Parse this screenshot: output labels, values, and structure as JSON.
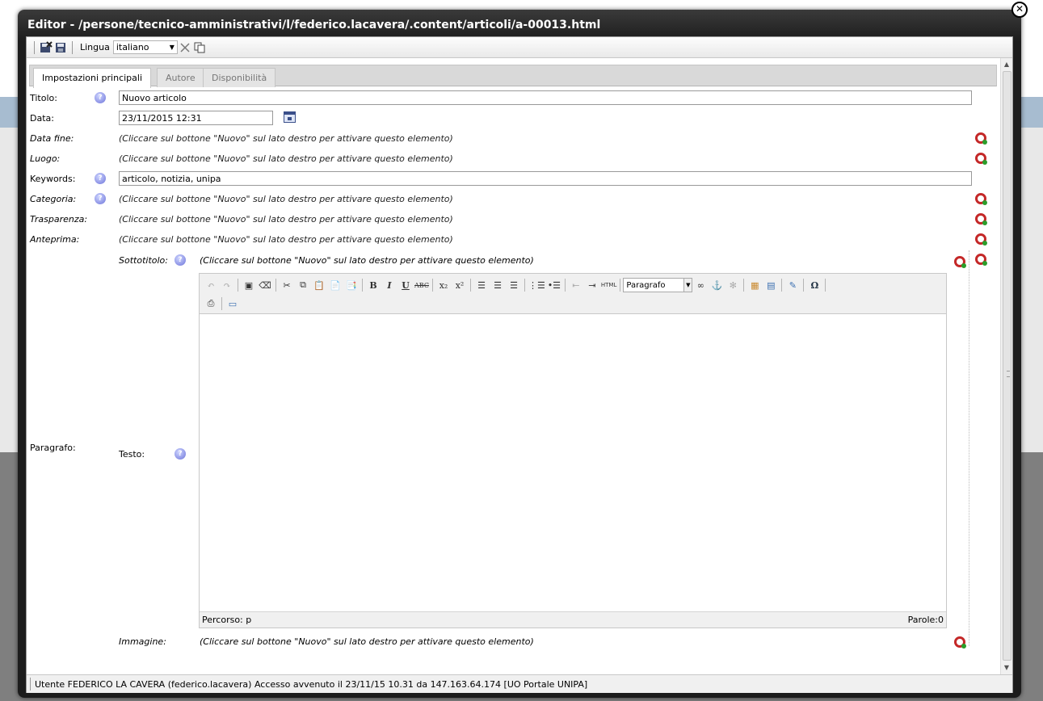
{
  "window": {
    "title": "Editor - /persone/tecnico-amministrativi/l/federico.lacavera/.content/articoli/a-00013.html",
    "close_label": "✕"
  },
  "toolbar": {
    "language_label": "Lingua",
    "language_value": "italiano",
    "icons": [
      "save-exit-icon",
      "save-icon",
      "delete-language-icon",
      "copy-language-icon"
    ]
  },
  "tabs": [
    {
      "label": "Impostazioni principali",
      "active": true
    },
    {
      "label": "Autore",
      "active": false
    },
    {
      "label": "Disponibilità",
      "active": false
    }
  ],
  "fields": {
    "titolo": {
      "label": "Titolo:",
      "value": "Nuovo articolo"
    },
    "data": {
      "label": "Data:",
      "value": "23/11/2015 12:31"
    },
    "data_fine": {
      "label": "Data fine:",
      "hint": "(Cliccare sul bottone \"Nuovo\" sul lato destro per attivare questo elemento)"
    },
    "luogo": {
      "label": "Luogo:",
      "hint": "(Cliccare sul bottone \"Nuovo\" sul lato destro per attivare questo elemento)"
    },
    "keywords": {
      "label": "Keywords:",
      "value": "articolo, notizia, unipa"
    },
    "categoria": {
      "label": "Categoria:",
      "hint": "(Cliccare sul bottone \"Nuovo\" sul lato destro per attivare questo elemento)"
    },
    "trasparenza": {
      "label": "Trasparenza:",
      "hint": "(Cliccare sul bottone \"Nuovo\" sul lato destro per attivare questo elemento)"
    },
    "anteprima": {
      "label": "Anteprima:",
      "hint": "(Cliccare sul bottone \"Nuovo\" sul lato destro per attivare questo elemento)"
    }
  },
  "paragrafo": {
    "label": "Paragrafo:",
    "sottotitolo": {
      "label": "Sottotitolo:",
      "hint": "(Cliccare sul bottone \"Nuovo\" sul lato destro per attivare questo elemento)"
    },
    "testo": {
      "label": "Testo:"
    },
    "immagine": {
      "label": "Immagine:",
      "hint": "(Cliccare sul bottone \"Nuovo\" sul lato destro per attivare questo elemento)"
    },
    "editor": {
      "format_value": "Paragrafo",
      "path_label": "Percorso: p",
      "word_count": "Parole:0"
    }
  },
  "status": {
    "text": "Utente FEDERICO LA CAVERA (federico.lacavera) Accesso avvenuto il 23/11/15 10.31 da 147.163.64.174 [UO Portale UNIPA]"
  },
  "colors": {
    "title_bar": "#1c1c1c",
    "add_icon_ring": "#c42828",
    "add_icon_dot": "#2a9d2a",
    "help_icon": "#6c73d9"
  }
}
